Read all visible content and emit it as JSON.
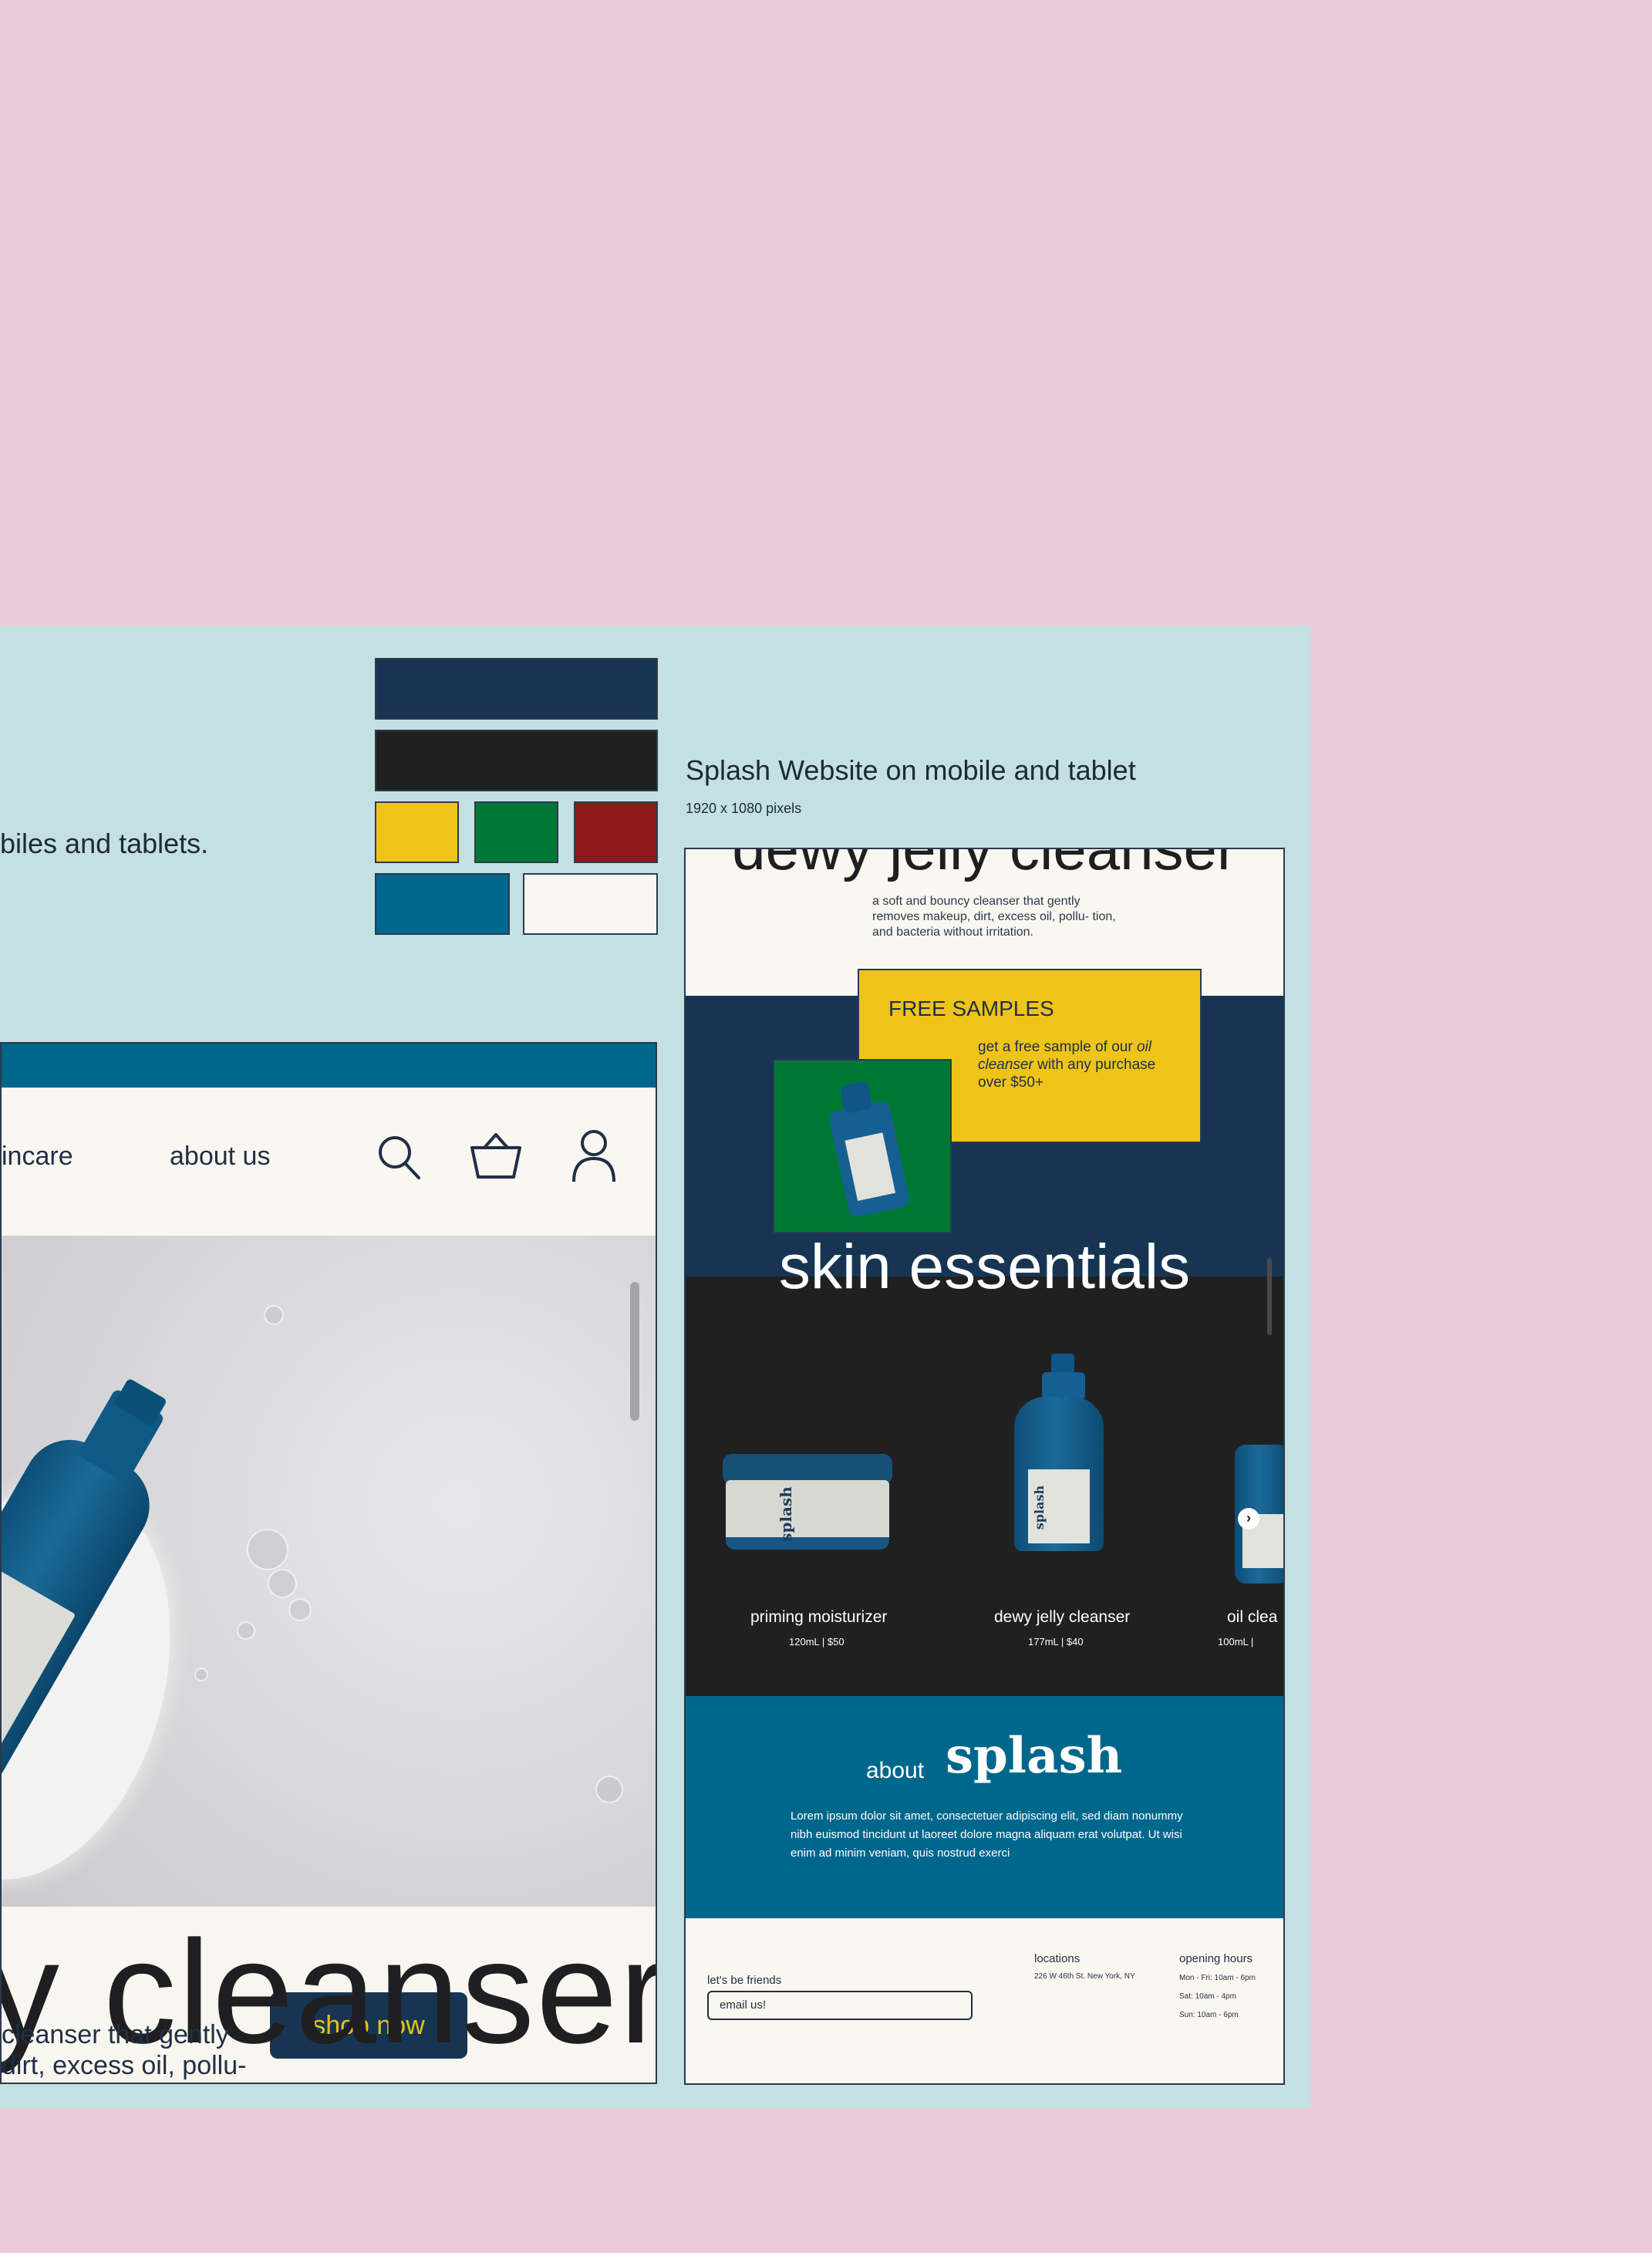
{
  "board": {
    "left_text": "biles and tablets.",
    "title": "Splash Website on mobile and tablet",
    "subtitle": "1920 x 1080 pixels",
    "palette": [
      "#173553",
      "#202021",
      "#efc418",
      "#007835",
      "#8f1a1c",
      "#00678c",
      "#faf6f0"
    ]
  },
  "tablet": {
    "nav": {
      "skincare": "incare",
      "about": "about us"
    },
    "shop_button": "shop now",
    "hero_title": "y cleanser",
    "desc_line1": "cleanser that gently",
    "desc_line2": "dirt, excess oil, pollu-"
  },
  "mobile": {
    "cut_title": "dewy jelly cleanser",
    "description": "a soft and bouncy cleanser that gently removes makeup, dirt, excess oil, pollu- tion, and bacteria without irritation.",
    "free_samples": {
      "heading": "FREE SAMPLES",
      "text_pre": "get a free sample of our ",
      "text_em": "oil cleanser",
      "text_post": " with any purchase over $50+"
    },
    "essentials_title": "skin essentials",
    "products": [
      {
        "name": "priming moisturizer",
        "price": "120mL | $50"
      },
      {
        "name": "dewy jelly cleanser",
        "price": "177mL | $40"
      },
      {
        "name": "oil clea",
        "price": "100mL |"
      }
    ],
    "product_brand": "splash",
    "about": {
      "prefix": "about",
      "logo": "splash",
      "lorem": "Lorem ipsum dolor sit amet, consectetuer adipiscing elit, sed diam nonummy nibh euismod tincidunt ut laoreet dolore magna aliquam erat volutpat. Ut wisi enim ad minim veniam, quis nostrud exerci"
    },
    "footer": {
      "friends_label": "let's be friends",
      "email_placeholder": "email us!",
      "locations_heading": "locations",
      "locations_address": "226 W 46th St. New York, NY",
      "hours_heading": "opening hours",
      "hours": [
        "Mon - Fri: 10am - 6pm",
        "Sat: 10am - 4pm",
        "Sun: 10am - 6pm"
      ]
    }
  }
}
